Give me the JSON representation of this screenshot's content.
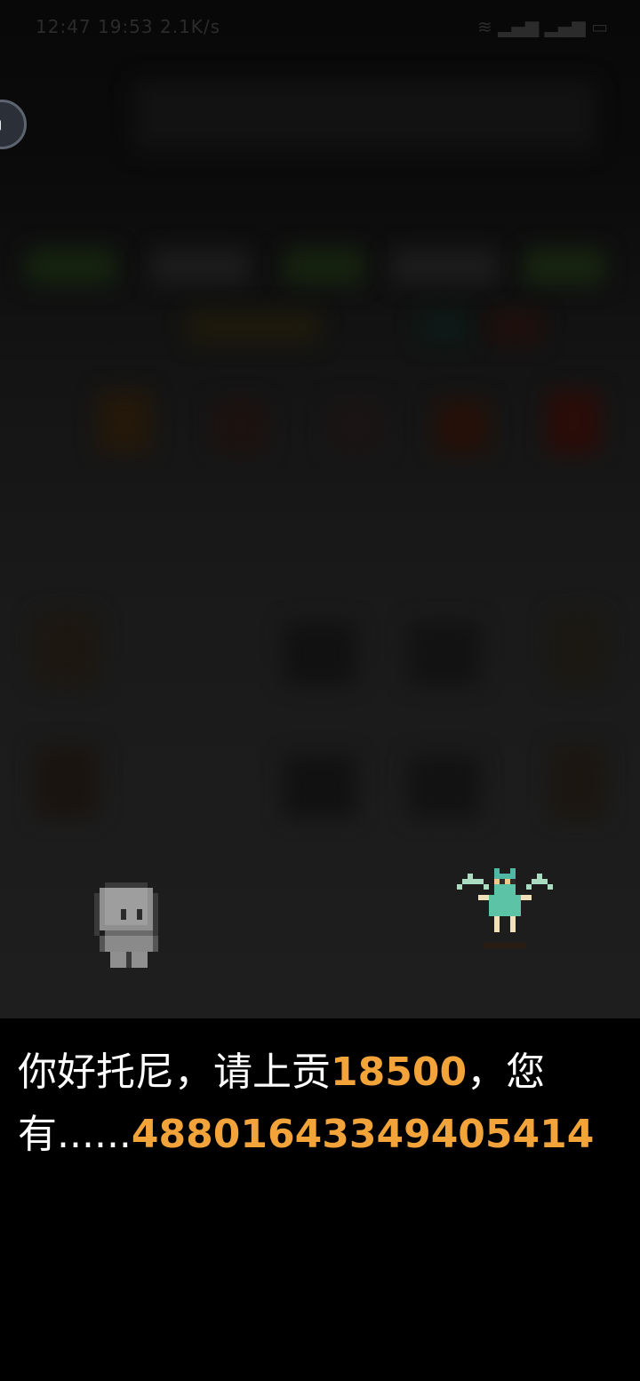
{
  "status_bar": {
    "time": "12:47 19:53 2.1K/s",
    "icons": "≋ ▂▄▆ ▂▄▆ ▭"
  },
  "dialogue": {
    "part1": "你好托尼，请上贡",
    "tribute_amount": "18500",
    "part2": "，您有......",
    "owned_amount": "48801643349405414"
  },
  "colors": {
    "highlight": "#f2a43a",
    "text": "#ffffff",
    "background": "#000000"
  },
  "icons": {
    "assistant": "assistant-ball-icon",
    "player": "ghost-player-sprite",
    "npc": "green-fairy-npc-sprite"
  }
}
